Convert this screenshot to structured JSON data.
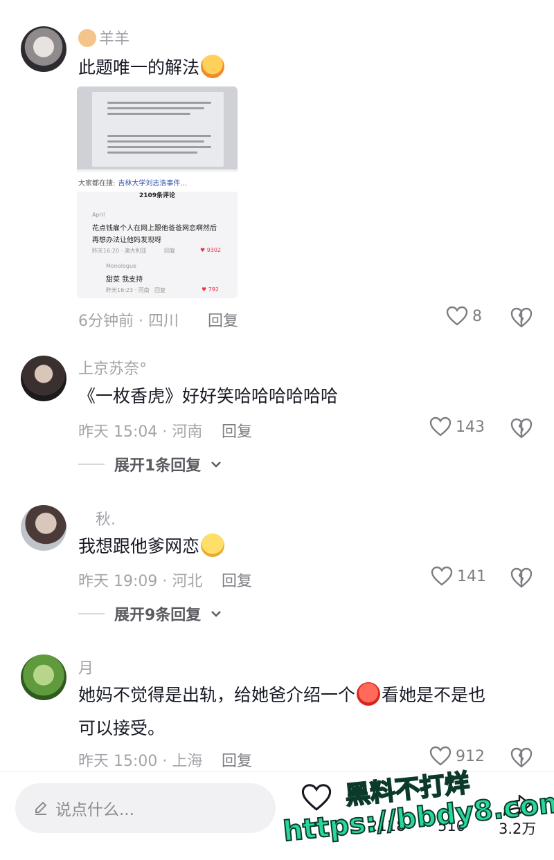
{
  "comments": [
    {
      "username": "羊羊",
      "text": "此题唯一的解法",
      "meta": "6分钟前 · 四川",
      "reply": "回复",
      "likes": "8",
      "image": {
        "search_prefix": "大家都在搜:",
        "search_keyword": "吉林大学刘志浩事件...",
        "comment_count": "2109条评论",
        "c1_user": "April",
        "c1_line1": "花点钱雇个人在网上跟他爸爸网恋啊",
        "c1_line1_suffix": "然后",
        "c1_line2": "再想办法让他妈发现呀",
        "c1_meta": "昨天16:20 · 澳大利亚",
        "c1_reply": "回复",
        "c1_likes": "9302",
        "c2_user": "Monologue",
        "c2_text": "甜菜 我支持",
        "c2_meta": "昨天16:23 · 河南",
        "c2_reply": "回复",
        "c2_likes": "792"
      }
    },
    {
      "username": "上京苏奈°",
      "text": "《一枚香虎》好好笑哈哈哈哈哈哈",
      "meta": "昨天 15:04 · 河南",
      "reply": "回复",
      "likes": "143",
      "expand": "展开1条回复"
    },
    {
      "username": "秋.",
      "text": "我想跟他爹网恋",
      "meta": "昨天 19:09 · 河北",
      "reply": "回复",
      "likes": "141",
      "expand": "展开9条回复"
    },
    {
      "username": "月",
      "text_line1_a": "她妈不觉得是出轨，给她爸介绍一个",
      "text_line1_b": "看她是不是也",
      "text_line2": "可以接受。",
      "meta": "昨天 15:00 · 上海",
      "reply": "回复",
      "likes": "912"
    }
  ],
  "bottom_bar": {
    "input_placeholder": "说点什么...",
    "like_count": "2118",
    "comment_count": "510",
    "share_count": "3.2万"
  },
  "watermark": {
    "line1": "黑料不打烊",
    "line2": "https://bbdy8.com"
  },
  "colors": {
    "text_primary": "#161823",
    "text_secondary": "#a3a4a9",
    "like_red": "#e5334b",
    "watermark_green": "#2ad79b"
  },
  "icons": [
    "dog-emoji-icon",
    "blush-emoji-icon",
    "heart-icon",
    "broken-heart-icon",
    "chevron-down-icon",
    "pencil-icon",
    "angry-emoji-icon",
    "smile-emoji-icon"
  ]
}
